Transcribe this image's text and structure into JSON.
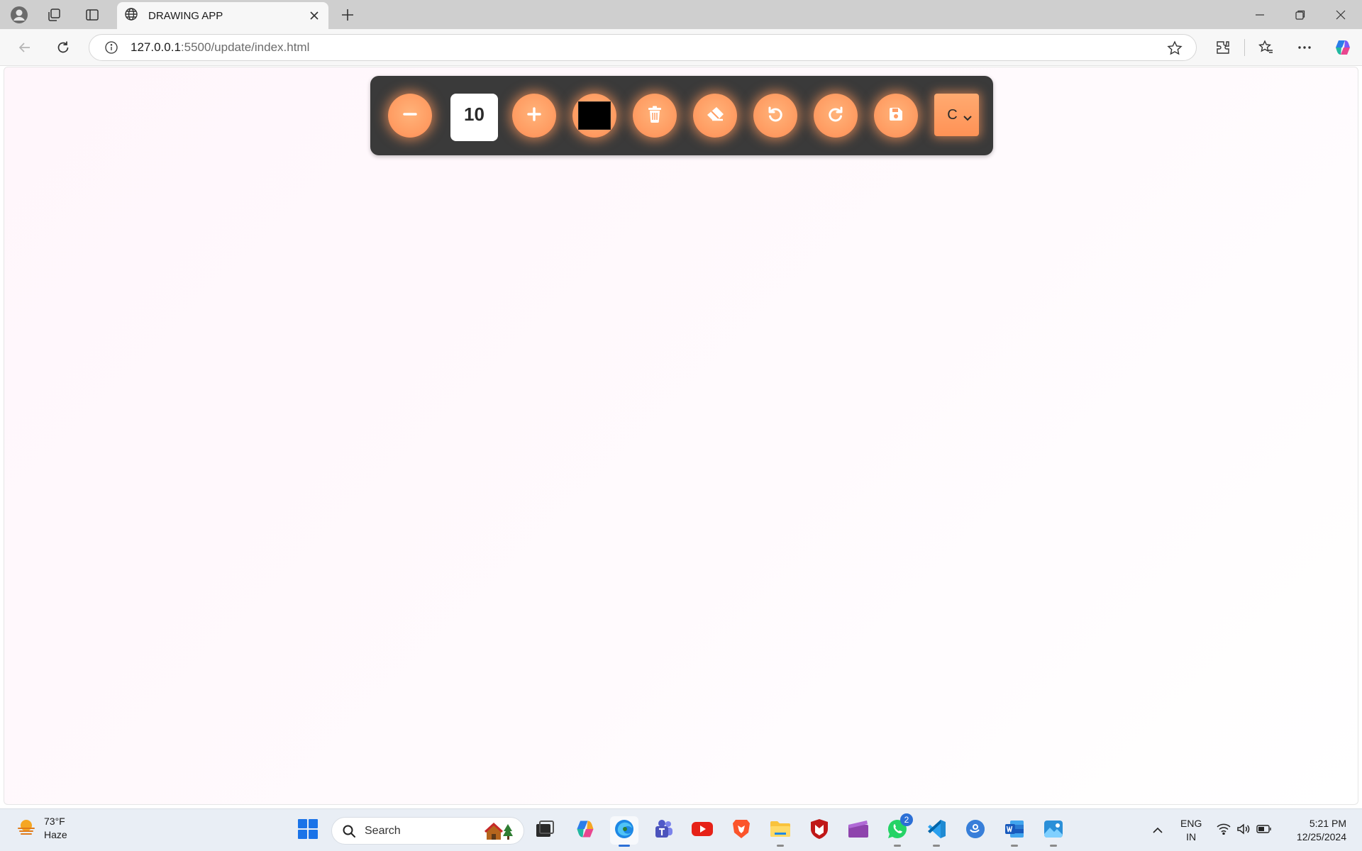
{
  "browser": {
    "tab_title": "DRAWING APP",
    "url_host": "127.0.0.1",
    "url_path": ":5500/update/index.html"
  },
  "app": {
    "brush_size": "10",
    "current_color": "#000000",
    "shape_selected": "C",
    "accent_color": "#ff9d63",
    "toolbar_background": "#3a3a3a"
  },
  "taskbar": {
    "weather_temp": "73°F",
    "weather_desc": "Haze",
    "search_label": "Search",
    "whatsapp_badge": "2",
    "lang_line1": "ENG",
    "lang_line2": "IN",
    "time": "5:21 PM",
    "date": "12/25/2024"
  },
  "icons": {
    "decrease": "minus-icon",
    "increase": "plus-icon",
    "clear": "trash-icon",
    "eraser": "eraser-icon",
    "undo": "undo-icon",
    "redo": "redo-icon",
    "save": "save-icon"
  }
}
